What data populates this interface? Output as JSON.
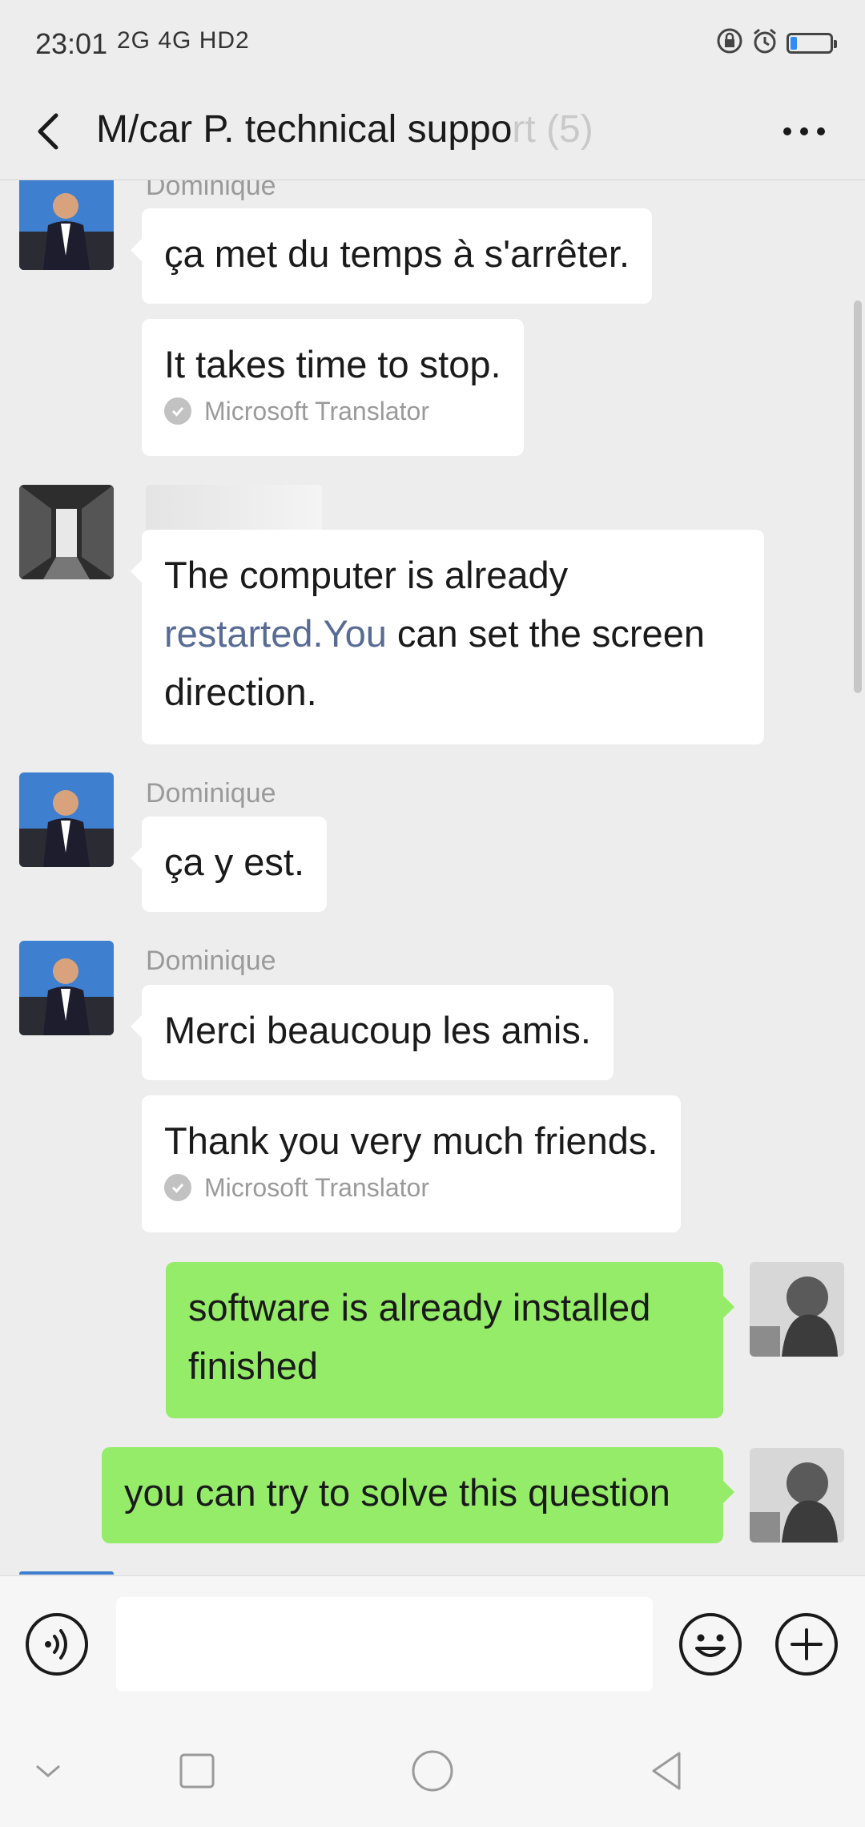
{
  "status_bar": {
    "time": "23:01",
    "network": "2G 4G HD2",
    "battery_percent": 15,
    "icons": [
      "lock-rotation-icon",
      "alarm-icon",
      "battery-icon"
    ],
    "battery_color": "#2f8df5"
  },
  "header": {
    "title": "M/car P. technical suppo",
    "title_faded": "rt (5)",
    "icons": [
      "back-arrow-icon",
      "more-icon"
    ]
  },
  "messages": [
    {
      "sender": "Dominique",
      "text": "ça met du temps à s'arrêter."
    },
    {
      "translation": "It takes time to stop.",
      "translator": "Microsoft Translator"
    },
    {
      "sender": "",
      "text_parts": [
        "The computer is already ",
        "restarted.You",
        " can set the screen direction."
      ]
    },
    {
      "sender": "Dominique",
      "text": "ça y est."
    },
    {
      "sender": "Dominique",
      "text": "Merci beaucoup les amis."
    },
    {
      "translation": "Thank you very much friends.",
      "translator": "Microsoft Translator"
    },
    {
      "sender": "me",
      "text": "software is already installed finished"
    },
    {
      "sender": "me",
      "text": "you can try to solve this question"
    }
  ],
  "input_bar": {
    "placeholder": "",
    "icons": [
      "voice-icon",
      "emoji-icon",
      "plus-icon"
    ]
  },
  "nav_bar": {
    "icons": [
      "chevron-down-icon",
      "recents-icon",
      "home-icon",
      "back-icon"
    ]
  },
  "colors": {
    "background": "#ededed",
    "bubble_me": "#95ec69",
    "bubble_other": "#ffffff",
    "link": "#576b95",
    "meta_text": "#9a9a9a"
  }
}
